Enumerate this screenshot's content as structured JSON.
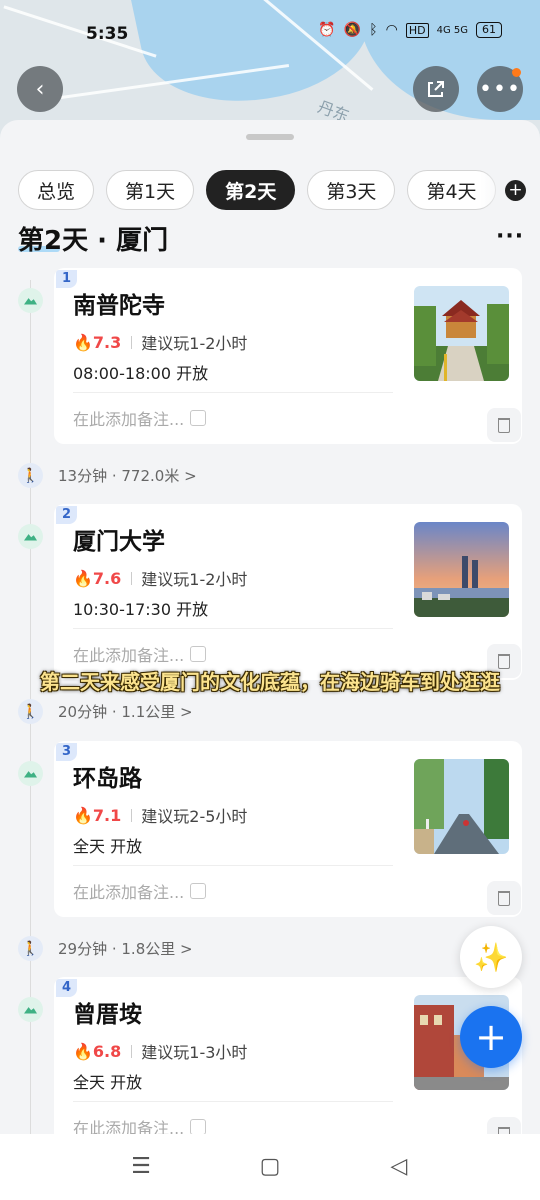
{
  "status_bar": {
    "time": "5:35",
    "network": "4G 5G",
    "hd": "HD",
    "battery": "61"
  },
  "map": {
    "label": "丹东"
  },
  "tabs": [
    {
      "label": "总览",
      "active": false
    },
    {
      "label": "第1天",
      "active": false
    },
    {
      "label": "第2天",
      "active": true
    },
    {
      "label": "第3天",
      "active": false
    },
    {
      "label": "第4天",
      "active": false
    }
  ],
  "day_title": "第2天 · 厦门",
  "note_placeholder": "在此添加备注...",
  "pois": [
    {
      "index": "1",
      "name": "南普陀寺",
      "heat": "7.3",
      "suggest": "建议玩1-2小时",
      "hours": "08:00-18:00 开放"
    },
    {
      "index": "2",
      "name": "厦门大学",
      "heat": "7.6",
      "suggest": "建议玩1-2小时",
      "hours": "10:30-17:30 开放"
    },
    {
      "index": "3",
      "name": "环岛路",
      "heat": "7.1",
      "suggest": "建议玩2-5小时",
      "hours": "全天 开放"
    },
    {
      "index": "4",
      "name": "曾厝垵",
      "heat": "6.8",
      "suggest": "建议玩1-3小时",
      "hours": "全天 开放"
    }
  ],
  "walks": [
    {
      "text": "13分钟 · 772.0米 >"
    },
    {
      "text": "20分钟 · 1.1公里 >"
    },
    {
      "text": "29分钟 · 1.8公里 >"
    }
  ],
  "subtitle": "第二天来感受厦门的文化底蕴，在海边骑车到处逛逛",
  "icons": {
    "back": "chevron-left-icon",
    "share": "share-icon",
    "more": "more-icon",
    "magic": "magic-wand-icon",
    "add": "plus-icon"
  },
  "colors": {
    "accent": "#1a73f0",
    "heat": "#f04848",
    "active_tab": "#222222"
  }
}
